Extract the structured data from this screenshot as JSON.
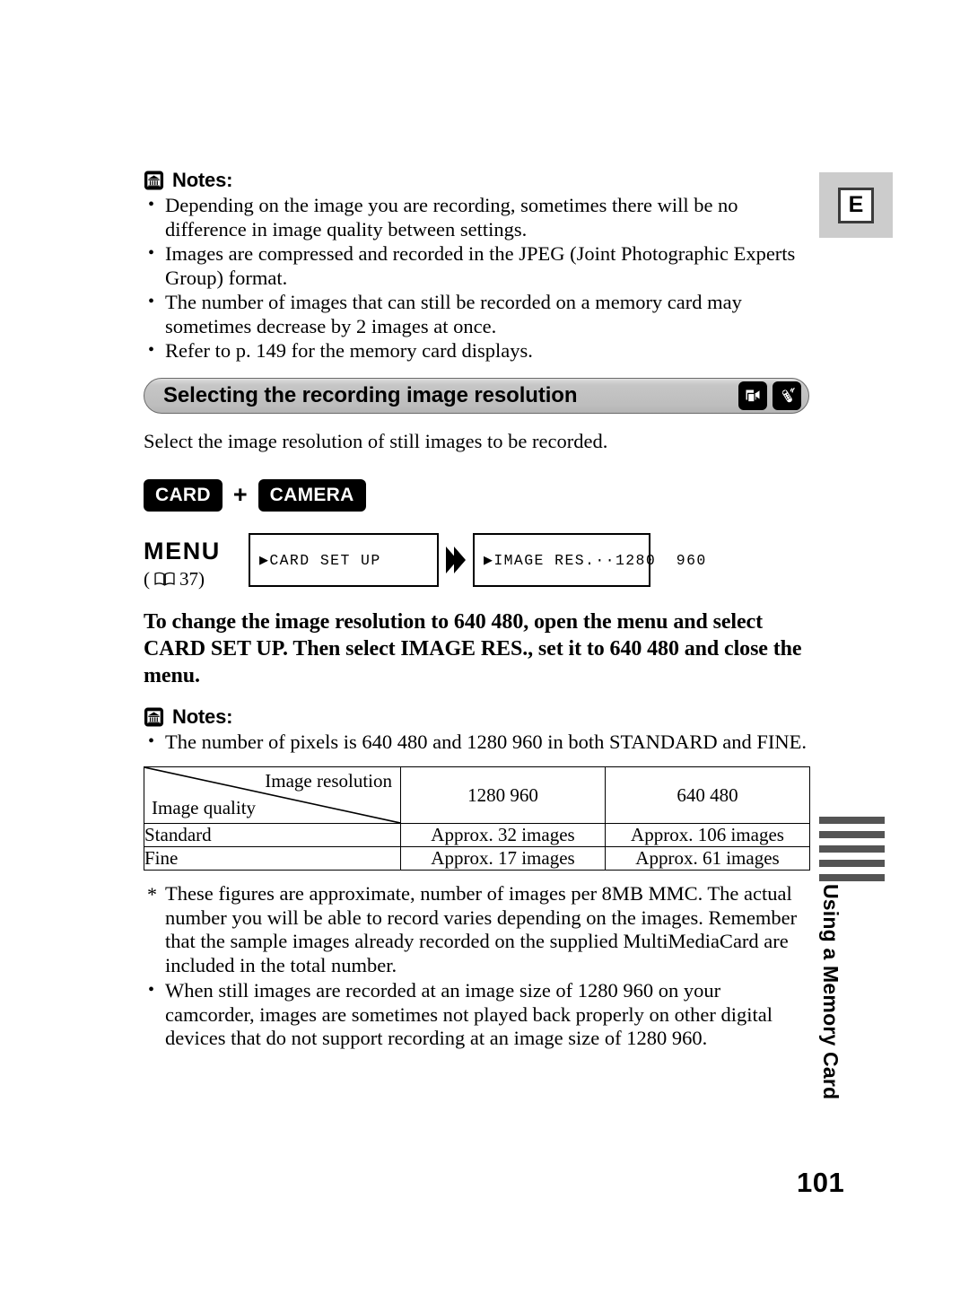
{
  "margin": {
    "language_tab": "E",
    "side_running_text": "Using a Memory Card",
    "page_number": "101"
  },
  "notes_top": {
    "heading": "Notes:",
    "items": [
      "Depending on the image you are recording, sometimes there will be no difference in image quality between settings.",
      "Images are compressed and recorded in the JPEG (Joint Photographic Experts Group) format.",
      "The number of images that can still be recorded on a memory card may sometimes decrease by 2 images at once.",
      "Refer to p. 149 for the memory card displays."
    ]
  },
  "section": {
    "title": "Selecting the recording image resolution",
    "intro": "Select the image resolution of still images to be recorded."
  },
  "modes": {
    "first": "CARD",
    "plus": "+",
    "second": "CAMERA"
  },
  "menu": {
    "label": "MENU",
    "ref_open": "(",
    "ref_page": "37)",
    "screen_1": "▶CARD SET UP",
    "screen_2": "▶IMAGE RES.··1280  960"
  },
  "instruction": "To change the image resolution to 640   480, open the menu and select CARD SET UP. Then select IMAGE RES., set it to 640   480 and close the menu.",
  "notes_bottom": {
    "heading": "Notes:",
    "items": [
      "The number of pixels is 640   480 and 1280   960 in both STANDARD and FINE."
    ]
  },
  "table": {
    "corner_top_right": "Image resolution",
    "corner_bottom_left": "Image quality",
    "columns": [
      "1280   960",
      "640   480"
    ],
    "rows": [
      {
        "label": "Standard",
        "values": [
          "Approx. 32 images",
          "Approx. 106 images"
        ]
      },
      {
        "label": "Fine",
        "values": [
          "Approx. 17 images",
          "Approx. 61 images"
        ]
      }
    ]
  },
  "footnote": "These figures are approximate, number of images per 8MB MMC. The actual number you will be able to record varies depending on the images. Remember that the sample images already recorded on the supplied MultiMediaCard are included in the total number.",
  "notes_tail": {
    "items": [
      "When still images are recorded at an image size of 1280   960 on your camcorder, images are sometimes not played back properly on other digital devices that do not support recording at an image size of 1280   960."
    ]
  }
}
